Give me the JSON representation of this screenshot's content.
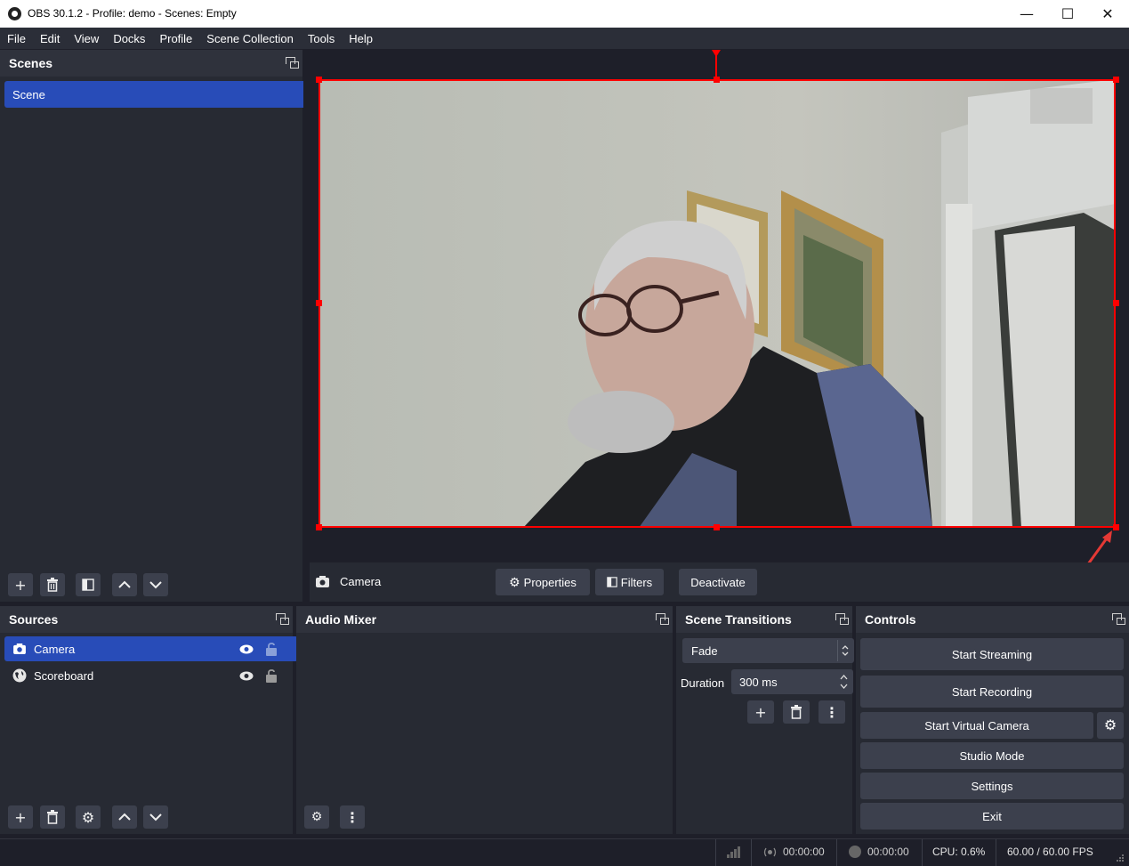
{
  "window": {
    "title": "OBS 30.1.2 - Profile: demo - Scenes: Empty"
  },
  "menu": [
    "File",
    "Edit",
    "View",
    "Docks",
    "Profile",
    "Scene Collection",
    "Tools",
    "Help"
  ],
  "scenes": {
    "title": "Scenes",
    "items": [
      "Scene"
    ]
  },
  "sources": {
    "title": "Sources",
    "items": [
      {
        "name": "Camera",
        "icon": "camera-icon"
      },
      {
        "name": "Scoreboard",
        "icon": "globe-icon"
      }
    ]
  },
  "audio_mixer": {
    "title": "Audio Mixer"
  },
  "transitions": {
    "title": "Scene Transitions",
    "type": "Fade",
    "duration_label": "Duration",
    "duration_value": "300 ms"
  },
  "controls": {
    "title": "Controls",
    "start_streaming": "Start Streaming",
    "start_recording": "Start Recording",
    "start_virtual_camera": "Start Virtual Camera",
    "studio_mode": "Studio Mode",
    "settings": "Settings",
    "exit": "Exit"
  },
  "context_bar": {
    "source_name": "Camera",
    "properties": "Properties",
    "filters": "Filters",
    "deactivate": "Deactivate"
  },
  "status": {
    "stream_time": "00:00:00",
    "record_time": "00:00:00",
    "cpu": "CPU: 0.6%",
    "fps": "60.00 / 60.00 FPS"
  },
  "colors": {
    "accent": "#284cb8",
    "selection_outline": "#ff0000",
    "annotation_arrow": "#e53935"
  }
}
